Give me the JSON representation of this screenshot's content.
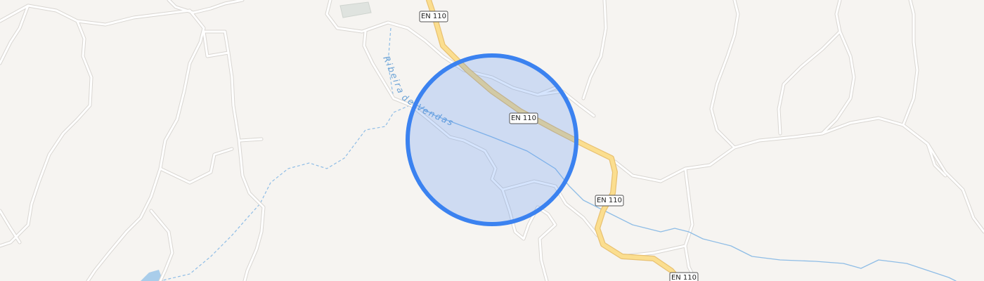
{
  "map": {
    "road_labels": [
      "EN 110",
      "EN 110",
      "EN 110",
      "EN 110"
    ],
    "river_label": "Ribeira de Vendas",
    "location_marker": {
      "fill": "#4285f4",
      "stroke": "#3b82f0"
    },
    "colors": {
      "background": "#f6f4f1",
      "minor_road": "#ffffff",
      "major_road": "#fbde8f",
      "water": "#8fbde6",
      "building": "#dfe3df"
    }
  }
}
